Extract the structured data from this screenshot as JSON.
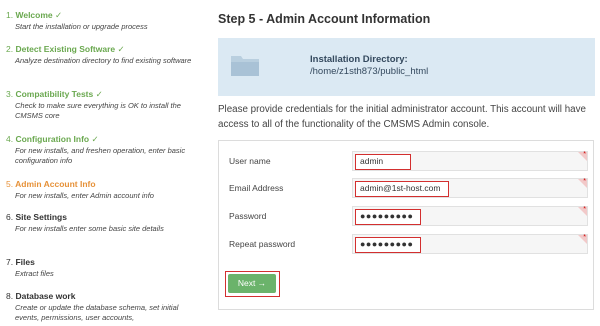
{
  "steps": [
    {
      "number": "1.",
      "title": "Welcome",
      "check": "✓",
      "description": "Start the installation or upgrade process",
      "status": "done"
    },
    {
      "number": "2.",
      "title": "Detect Existing Software",
      "check": "✓",
      "description": "Analyze destination directory to find existing software",
      "status": "done"
    },
    {
      "number": "3.",
      "title": "Compatibility Tests",
      "check": "✓",
      "description": "Check to make sure everything is OK to install the CMSMS core",
      "status": "done"
    },
    {
      "number": "4.",
      "title": "Configuration Info",
      "check": "✓",
      "description": "For new installs, and freshen operation, enter basic configuration info",
      "status": "done"
    },
    {
      "number": "5.",
      "title": "Admin Account Info",
      "check": "",
      "description": "For new installs, enter Admin account info",
      "status": "current"
    },
    {
      "number": "6.",
      "title": "Site Settings",
      "check": "",
      "description": "For new installs enter some basic site details",
      "status": "pending"
    },
    {
      "number": "7.",
      "title": "Files",
      "check": "",
      "description": "Extract files",
      "status": "pending"
    },
    {
      "number": "8.",
      "title": "Database work",
      "check": "",
      "description": "Create or update the database schema, set initial events, permissions, user accounts,",
      "status": "pending"
    }
  ],
  "main": {
    "heading": "Step 5 - Admin Account Information",
    "install_dir_label": "Installation Directory:",
    "install_dir_path": "/home/z1sth873/public_html",
    "intro": "Please provide credentials for the initial administrator account. This account will have access to all of the functionality of the CMSMS Admin console."
  },
  "form": {
    "username_label": "User name",
    "username_value": "admin",
    "email_label": "Email Address",
    "email_value": "admin@1st-host.com",
    "password_label": "Password",
    "password_value": "●●●●●●●●●",
    "repeat_label": "Repeat password",
    "repeat_value": "●●●●●●●●●",
    "required_mark": "*",
    "next_label": "Next →"
  },
  "colors": {
    "done": "#6aa84f",
    "current": "#e69138",
    "info_box": "#dbe9f3",
    "highlight": "#d32f2f",
    "next_button": "#6bb36b"
  }
}
